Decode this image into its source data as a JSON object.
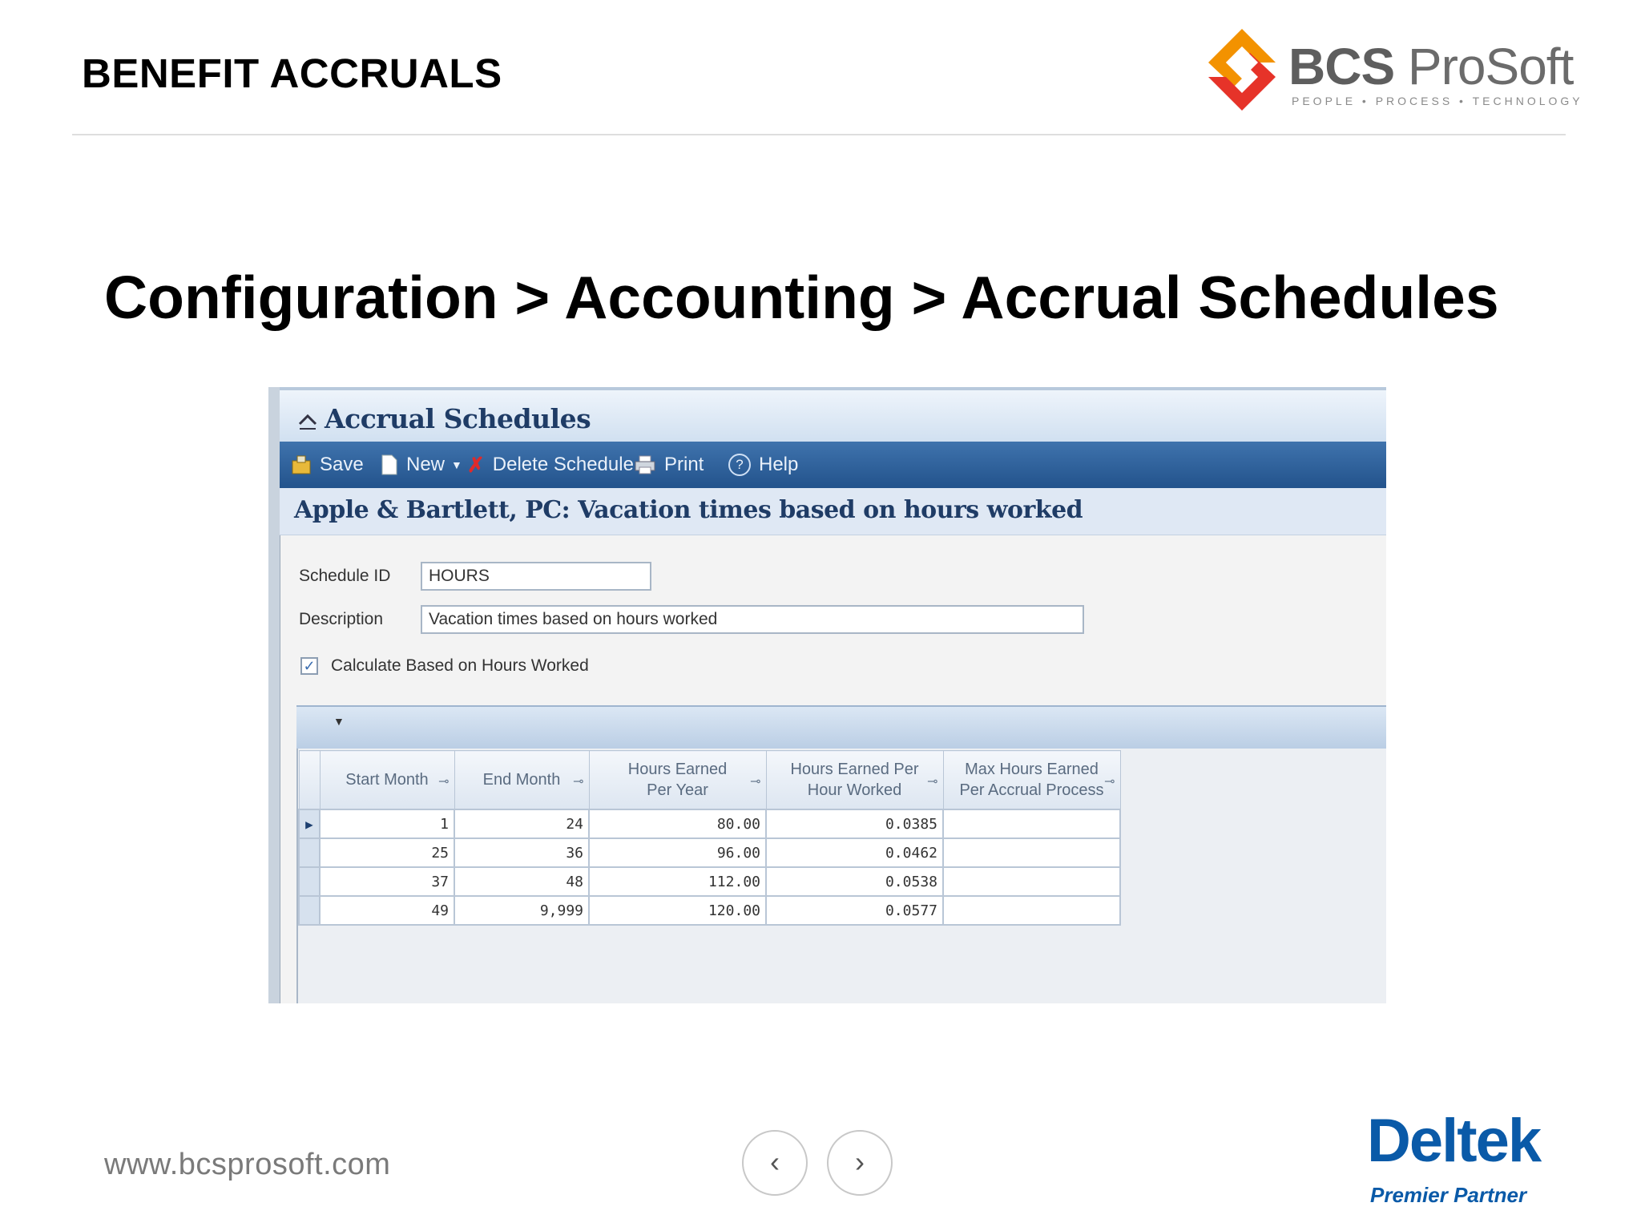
{
  "slide": {
    "header_title": "BENEFIT ACCRUALS",
    "breadcrumb": "Configuration > Accounting > Accrual Schedules",
    "website": "www.bcsprosoft.com"
  },
  "bcs_logo": {
    "brand_bold": "BCS",
    "brand_rest": "ProSoft",
    "tagline": "PEOPLE • PROCESS • TECHNOLOGY",
    "colors": {
      "red": "#e63329",
      "orange": "#f39200"
    }
  },
  "deltek_logo": {
    "word": "Deltek",
    "tagline": "Premier Partner",
    "color": "#0a5aa8"
  },
  "nav": {
    "prev_icon": "chevron-left-icon",
    "next_icon": "chevron-right-icon",
    "prev_glyph": "‹",
    "next_glyph": "›"
  },
  "app": {
    "title": "Accrual Schedules",
    "toolbar": {
      "save": "Save",
      "new": "New",
      "delete": "Delete Schedule",
      "print": "Print",
      "help": "Help"
    },
    "subtitle": "Apple & Bartlett, PC: Vacation times based on hours worked",
    "form": {
      "schedule_id_label": "Schedule ID",
      "schedule_id_value": "HOURS",
      "description_label": "Description",
      "description_value": "Vacation times based on hours worked",
      "calc_label": "Calculate Based on Hours Worked",
      "calc_checked": true
    },
    "grid": {
      "columns": [
        "Start Month",
        "End Month",
        "Hours Earned Per Year",
        "Hours Earned Per Hour Worked",
        "Max Hours Earned Per Accrual Process"
      ],
      "rows": [
        [
          "1",
          "24",
          "80.00",
          "0.0385",
          ""
        ],
        [
          "25",
          "36",
          "96.00",
          "0.0462",
          ""
        ],
        [
          "37",
          "48",
          "112.00",
          "0.0538",
          ""
        ],
        [
          "49",
          "9,999",
          "120.00",
          "0.0577",
          ""
        ]
      ],
      "selected_row": 0
    },
    "colors": {
      "toolbar": "#2f5f99",
      "title_text": "#1f3c66"
    }
  }
}
